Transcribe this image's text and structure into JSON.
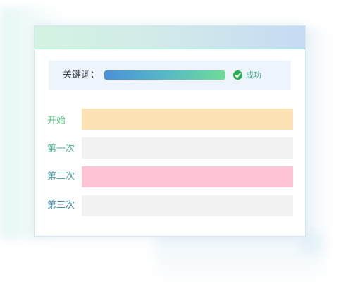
{
  "keyword": {
    "label": "关键词：",
    "progress": 1.0,
    "status_icon": "check-circle-icon",
    "status_text": "成功"
  },
  "attempts": [
    {
      "label": "开始",
      "label_color": "#53c283",
      "bar_color": "#fde2b5"
    },
    {
      "label": "第一次",
      "label_color": "#4db394",
      "bar_color": "#f2f2f2"
    },
    {
      "label": "第二次",
      "label_color": "#479fa6",
      "bar_color": "#fdc4d6"
    },
    {
      "label": "第三次",
      "label_color": "#3d89ae",
      "bar_color": "#f2f2f2"
    }
  ],
  "colors": {
    "title_bar_start": "#d4f3e2",
    "title_bar_end": "#c5dbf4",
    "keyword_panel": "#edf4fb",
    "success": "#22b14c"
  }
}
